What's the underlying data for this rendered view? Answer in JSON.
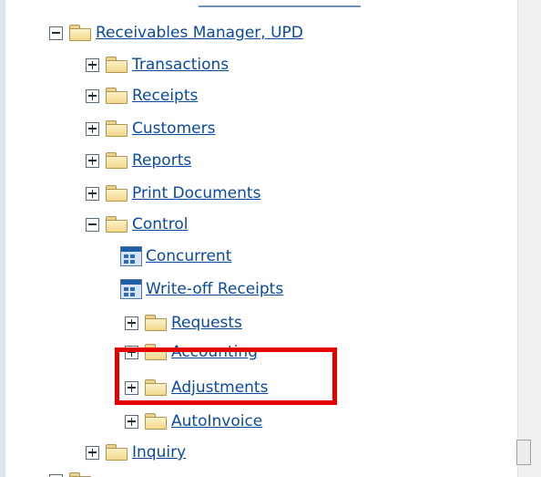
{
  "navigator": {
    "root": {
      "label": "Receivables Manager, UPD",
      "state": "expanded"
    },
    "items": [
      {
        "label": "Transactions",
        "state": "collapsed"
      },
      {
        "label": "Receipts",
        "state": "collapsed"
      },
      {
        "label": "Customers",
        "state": "collapsed"
      },
      {
        "label": "Reports",
        "state": "collapsed"
      },
      {
        "label": "Print Documents",
        "state": "collapsed"
      },
      {
        "label": "Control",
        "state": "expanded"
      },
      {
        "label": "Inquiry",
        "state": "collapsed"
      }
    ],
    "control_children": [
      {
        "label": "Concurrent",
        "type": "function"
      },
      {
        "label": "Write-off Receipts",
        "type": "function"
      },
      {
        "label": "Requests",
        "type": "folder",
        "state": "collapsed"
      },
      {
        "label": "Accounting",
        "type": "folder",
        "state": "collapsed"
      },
      {
        "label": "Adjustments",
        "type": "folder",
        "state": "collapsed"
      },
      {
        "label": "AutoInvoice",
        "type": "folder",
        "state": "collapsed"
      }
    ]
  },
  "colors": {
    "link": "#0a4a9e",
    "highlight": "#e50000",
    "folder": "#f3d88b"
  },
  "icons": {
    "expand": "plus-box-icon",
    "collapse": "minus-box-icon",
    "folder": "folder-icon",
    "function": "function-form-icon"
  }
}
